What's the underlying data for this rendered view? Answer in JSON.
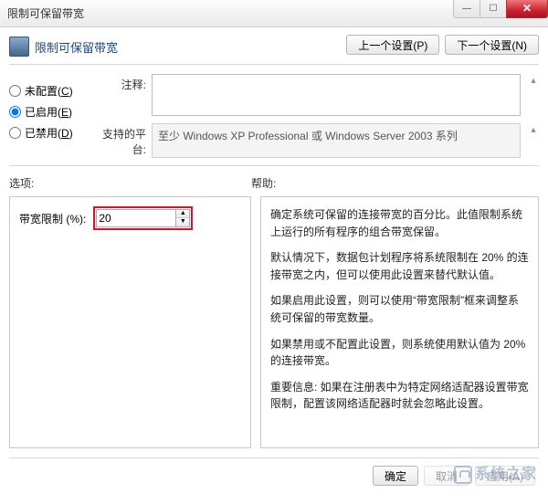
{
  "window": {
    "title": "限制可保留带宽"
  },
  "header": {
    "title": "限制可保留带宽",
    "prev_btn": "上一个设置(P)",
    "next_btn": "下一个设置(N)"
  },
  "radios": {
    "not_configured": "未配置",
    "not_configured_key": "C",
    "enabled": "已启用",
    "enabled_key": "E",
    "disabled": "已禁用",
    "disabled_key": "D",
    "selected": "enabled"
  },
  "fields": {
    "comment_label": "注释:",
    "comment_value": "",
    "platform_label": "支持的平台:",
    "platform_value": "至少 Windows XP Professional 或 Windows Server 2003 系列"
  },
  "sections": {
    "options": "选项:",
    "help": "帮助:"
  },
  "options": {
    "bandwidth_label": "带宽限制 (%):",
    "bandwidth_value": "20"
  },
  "help": {
    "p1": "确定系统可保留的连接带宽的百分比。此值限制系统上运行的所有程序的组合带宽保留。",
    "p2": "默认情况下，数据包计划程序将系统限制在 20% 的连接带宽之内，但可以使用此设置来替代默认值。",
    "p3": "如果启用此设置，则可以使用“带宽限制”框来调整系统可保留的带宽数量。",
    "p4": "如果禁用或不配置此设置，则系统使用默认值为 20% 的连接带宽。",
    "p5": "重要信息: 如果在注册表中为特定网络适配器设置带宽限制，配置该网络适配器时就会忽略此设置。"
  },
  "footer": {
    "ok": "确定",
    "cancel": "取消",
    "apply": "应用(A)"
  },
  "watermark": "系统之家"
}
